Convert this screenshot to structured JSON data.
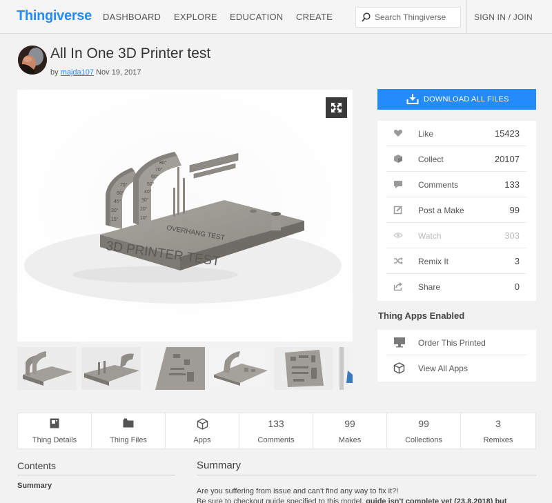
{
  "header": {
    "logo": "Thingiverse",
    "nav": [
      "DASHBOARD",
      "EXPLORE",
      "EDUCATION",
      "CREATE"
    ],
    "search_placeholder": "Search Thingiverse",
    "signin": "SIGN IN / JOIN"
  },
  "thing": {
    "title": "All In One 3D Printer test",
    "by": "by",
    "author": "majda107",
    "date": "Nov 19, 2017",
    "model_text": {
      "main": "3D PRINTER TEST",
      "sub": "OVERHANG TEST",
      "angles_left": [
        "75°",
        "60°",
        "45°",
        "30°",
        "15°"
      ],
      "angles_right": [
        "80°",
        "70°",
        "60°",
        "50°",
        "40°",
        "30°",
        "20°",
        "10°"
      ]
    }
  },
  "download_label": "DOWNLOAD ALL FILES",
  "stats": [
    {
      "icon": "heart-icon",
      "label": "Like",
      "count": "15423"
    },
    {
      "icon": "collect-icon",
      "label": "Collect",
      "count": "20107"
    },
    {
      "icon": "comment-icon",
      "label": "Comments",
      "count": "133"
    },
    {
      "icon": "post-make-icon",
      "label": "Post a Make",
      "count": "99"
    },
    {
      "icon": "eye-icon",
      "label": "Watch",
      "count": "303"
    },
    {
      "icon": "remix-icon",
      "label": "Remix It",
      "count": "3"
    },
    {
      "icon": "share-icon",
      "label": "Share",
      "count": "0"
    }
  ],
  "apps": {
    "title": "Thing Apps Enabled",
    "items": [
      {
        "icon": "printer-icon",
        "label": "Order This Printed"
      },
      {
        "icon": "cube-icon",
        "label": "View All Apps"
      }
    ]
  },
  "tabs": [
    {
      "icon": "details-icon",
      "value": "",
      "label": "Thing Details"
    },
    {
      "icon": "folder-icon",
      "value": "",
      "label": "Thing Files"
    },
    {
      "icon": "cube-icon",
      "value": "",
      "label": "Apps"
    },
    {
      "icon": "",
      "value": "133",
      "label": "Comments"
    },
    {
      "icon": "",
      "value": "99",
      "label": "Makes"
    },
    {
      "icon": "",
      "value": "99",
      "label": "Collections"
    },
    {
      "icon": "",
      "value": "3",
      "label": "Remixes"
    }
  ],
  "contents": {
    "heading": "Contents",
    "item": "Summary"
  },
  "summary": {
    "heading": "Summary",
    "line1": "Are you suffering from issue and can't find any way to fix it?!",
    "line2_start": "Be sure to checkout guide specified to this model,",
    "line2_bold": "guide isn't complete yet (23.8.2018) but"
  },
  "colors": {
    "accent": "#248bfb",
    "icon_gray": "#9a9a9a"
  }
}
